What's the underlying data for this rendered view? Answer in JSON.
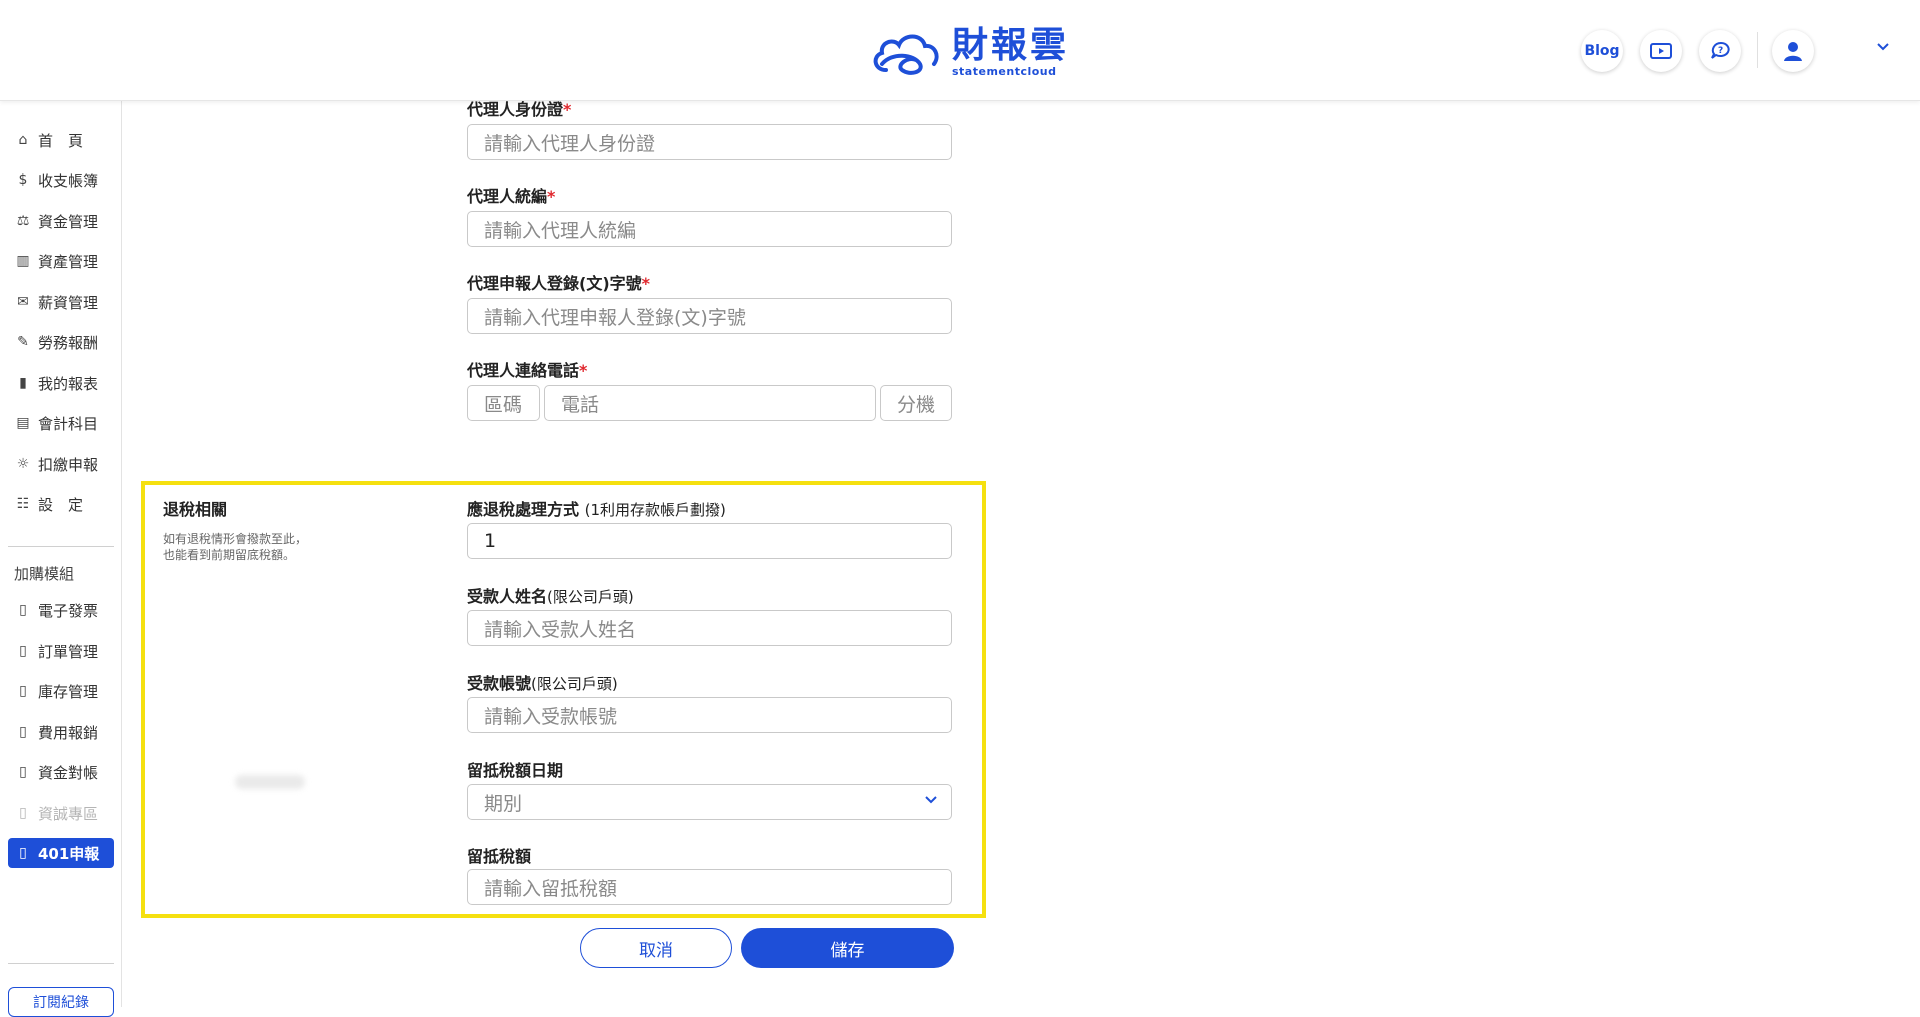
{
  "brand": {
    "title": "財報雲",
    "subtitle": "statementcloud",
    "color": "#1e4fd8"
  },
  "header": {
    "blog_label": "Blog",
    "video_icon": "video-guide-icon",
    "help_icon": "help-chat-icon",
    "user_icon": "user-avatar-icon",
    "menu_icon": "chevron-down-icon"
  },
  "sidebar": {
    "items": [
      {
        "label": "首　頁",
        "icon": "home-icon"
      },
      {
        "label": "收支帳簿",
        "icon": "ledger-icon"
      },
      {
        "label": "資金管理",
        "icon": "fund-icon"
      },
      {
        "label": "資產管理",
        "icon": "asset-icon"
      },
      {
        "label": "薪資管理",
        "icon": "salary-icon"
      },
      {
        "label": "勞務報酬",
        "icon": "labor-icon"
      },
      {
        "label": "我的報表",
        "icon": "report-icon"
      },
      {
        "label": "會計科目",
        "icon": "account-icon"
      },
      {
        "label": "扣繳申報",
        "icon": "withholding-icon"
      },
      {
        "label": "設　定",
        "icon": "settings-icon"
      }
    ],
    "addon_heading": "加購模組",
    "addons": [
      {
        "label": "電子發票",
        "icon": "module-icon"
      },
      {
        "label": "訂單管理",
        "icon": "module-icon"
      },
      {
        "label": "庫存管理",
        "icon": "module-icon"
      },
      {
        "label": "費用報銷",
        "icon": "module-icon"
      },
      {
        "label": "資金對帳",
        "icon": "module-icon"
      },
      {
        "label": "資誠專區",
        "icon": "module-icon",
        "disabled": true
      },
      {
        "label": "401申報",
        "icon": "module-icon",
        "active": true
      }
    ],
    "subscription_label": "訂閱紀錄"
  },
  "form": {
    "agent_id": {
      "label": "代理人身份證",
      "placeholder": "請輸入代理人身份證"
    },
    "agent_tax_id": {
      "label": "代理人統編",
      "placeholder": "請輸入代理人統編"
    },
    "agent_reg_no": {
      "label": "代理申報人登錄(文)字號",
      "placeholder": "請輸入代理申報人登錄(文)字號"
    },
    "agent_phone": {
      "label": "代理人連絡電話",
      "area_placeholder": "區碼",
      "phone_placeholder": "電話",
      "ext_placeholder": "分機"
    }
  },
  "refund_section": {
    "title": "退稅相關",
    "description_line1": "如有退稅情形會撥款至此，",
    "description_line2": "也能看到前期留底稅額。",
    "method": {
      "label": "應退稅處理方式",
      "note": "(1利用存款帳戶劃撥)",
      "value": "1"
    },
    "payee_name": {
      "label": "受款人姓名",
      "note": "(限公司戶頭)",
      "placeholder": "請輸入受款人姓名"
    },
    "payee_account": {
      "label": "受款帳號",
      "note": "(限公司戶頭)",
      "placeholder": "請輸入受款帳號"
    },
    "retained_date": {
      "label": "留抵稅額日期",
      "placeholder": "期別"
    },
    "retained_amount": {
      "label": "留抵稅額",
      "placeholder": "請輸入留抵稅額"
    }
  },
  "actions": {
    "cancel_label": "取消",
    "save_label": "儲存"
  },
  "colors": {
    "accent": "#1e4fd8",
    "highlight": "#f5e010",
    "required": "#e0282e"
  }
}
